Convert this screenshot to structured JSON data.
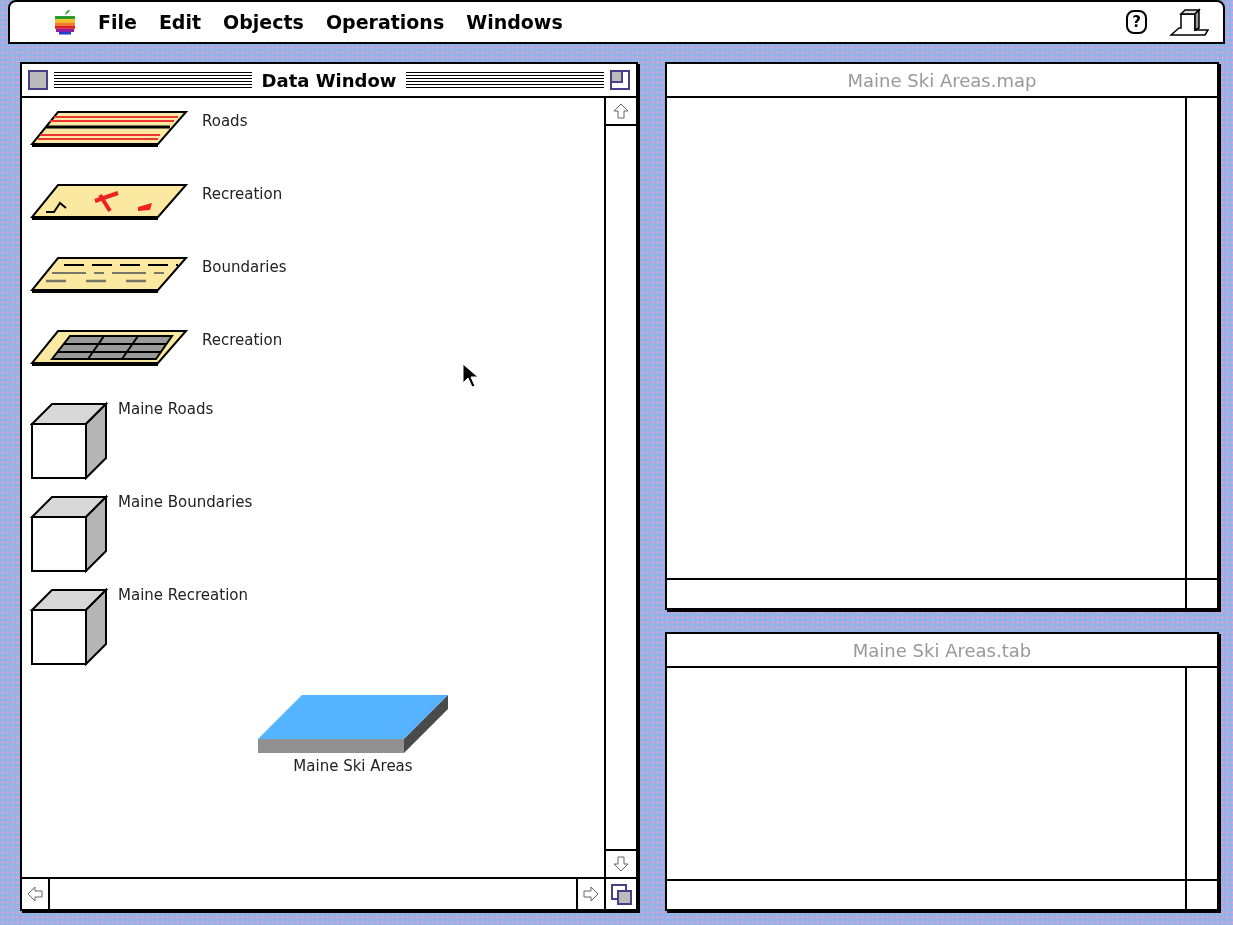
{
  "menu_bar": {
    "items": [
      {
        "label": "File"
      },
      {
        "label": "Edit"
      },
      {
        "label": "Objects"
      },
      {
        "label": "Operations"
      },
      {
        "label": "Windows"
      }
    ],
    "help_icon_label": "?"
  },
  "data_window": {
    "title": "Data Window",
    "items": [
      {
        "kind": "layer",
        "label": "Roads"
      },
      {
        "kind": "layer",
        "label": "Recreation"
      },
      {
        "kind": "layer",
        "label": "Boundaries"
      },
      {
        "kind": "layer",
        "label": "Recreation"
      },
      {
        "kind": "table",
        "label": "Maine Roads"
      },
      {
        "kind": "table",
        "label": "Maine Boundaries"
      },
      {
        "kind": "table",
        "label": "Maine Recreation"
      },
      {
        "kind": "view",
        "label": "Maine Ski Areas"
      }
    ]
  },
  "windows": [
    {
      "title": "Maine Ski Areas.map",
      "active": false
    },
    {
      "title": "Maine Ski Areas.tab",
      "active": false
    }
  ]
}
